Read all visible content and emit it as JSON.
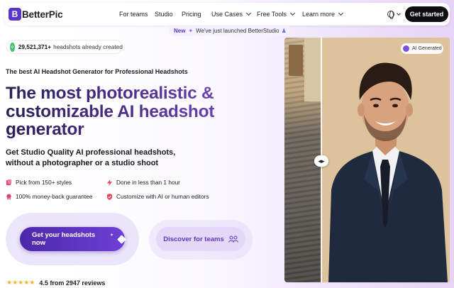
{
  "nav": {
    "logo_mark": "B",
    "logo_text": "BetterPic",
    "links": [
      {
        "label": "For teams"
      },
      {
        "label": "Studio"
      },
      {
        "label": "Pricing"
      },
      {
        "label": "Use Cases"
      },
      {
        "label": "Free Tools"
      },
      {
        "label": "Learn more"
      }
    ],
    "cta": "Get started"
  },
  "announcement": {
    "badge": "New",
    "text": "We've just launched BetterStudio"
  },
  "counter": {
    "count": "29,521,371+",
    "text": "headshots already created"
  },
  "hero": {
    "eyebrow": "The best AI Headshot Generator for Professional Headshots",
    "title_line1": "The most photorealistic &",
    "title_line2": "customizable AI headshot",
    "title_line3": "generator",
    "subtitle_line1": "Get Studio Quality AI professional headshots,",
    "subtitle_line2": "without a photographer or a studio shoot"
  },
  "features": [
    {
      "text": "Pick from 150+ styles",
      "color": "#d9437a"
    },
    {
      "text": "Done in less than 1 hour",
      "color": "#e0475e"
    },
    {
      "text": "100% money-back guarantee",
      "color": "#d9437a"
    },
    {
      "text": "Customize with AI or human editors",
      "color": "#e0475e"
    }
  ],
  "buttons": {
    "primary": "Get your headshots now",
    "secondary": "Discover for teams"
  },
  "rating": {
    "stars": "★★★★★",
    "value": 4.5,
    "text": "4.5 from 2947 reviews"
  },
  "image_panel": {
    "badge": "AI Generated",
    "handle_glyph": "◂▸"
  },
  "colors": {
    "brand": "#5b35c9",
    "accent_gradient_start": "#4b28a8",
    "accent_gradient_end": "#6e3fd6",
    "cta_dark": "#0d0d12",
    "star": "#f4b522"
  }
}
